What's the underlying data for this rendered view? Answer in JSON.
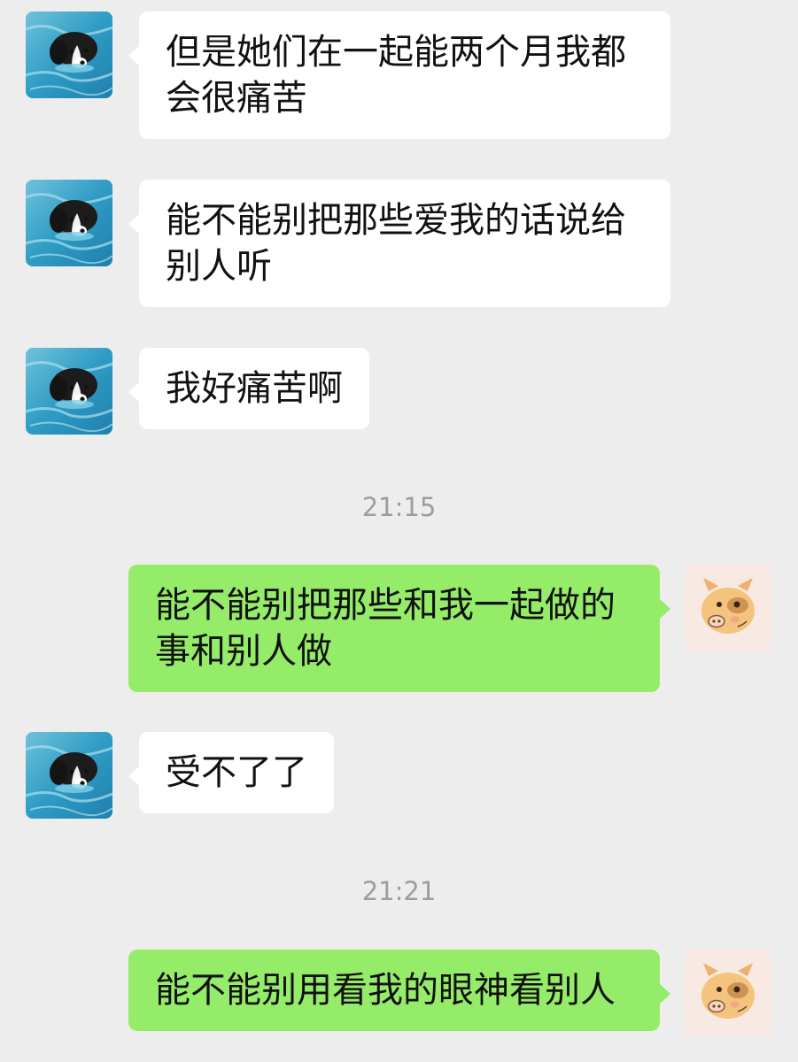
{
  "chat": {
    "messages": [
      {
        "sender": "other",
        "avatar_icon": "dog-swimming-avatar-icon",
        "text": "但是她们在一起能两个月我都会很痛苦"
      },
      {
        "sender": "other",
        "avatar_icon": "dog-swimming-avatar-icon",
        "text": "能不能别把那些爱我的话说给别人听"
      },
      {
        "sender": "other",
        "avatar_icon": "dog-swimming-avatar-icon",
        "text": "我好痛苦啊"
      },
      {
        "type": "timestamp",
        "text": "21:15"
      },
      {
        "sender": "self",
        "avatar_icon": "pig-avatar-icon",
        "text": "能不能别把那些和我一起做的事和别人做"
      },
      {
        "sender": "other",
        "avatar_icon": "dog-swimming-avatar-icon",
        "text": "受不了了"
      },
      {
        "type": "timestamp",
        "text": "21:21"
      },
      {
        "sender": "self",
        "avatar_icon": "pig-avatar-icon",
        "text": "能不能别用看我的眼神看别人"
      }
    ]
  },
  "colors": {
    "background": "#ededed",
    "incoming_bubble": "#ffffff",
    "outgoing_bubble": "#95ec69",
    "timestamp_text": "#9d9d9d"
  }
}
